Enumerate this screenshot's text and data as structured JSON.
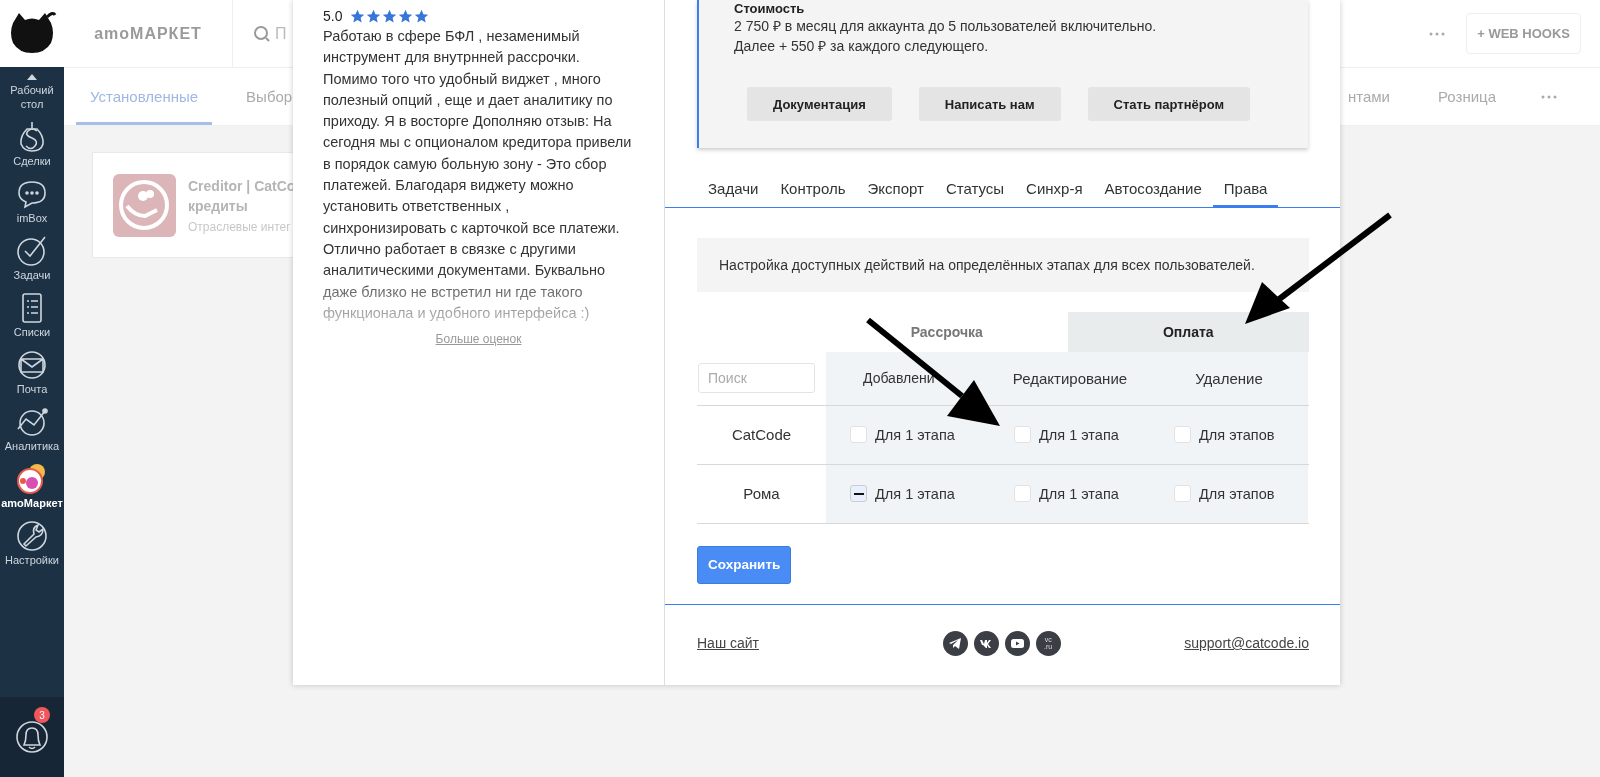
{
  "sidebar": {
    "items": [
      {
        "label": "Рабочий стол",
        "kind": "desktop",
        "selected": false
      },
      {
        "label": "Сделки",
        "kind": "deals",
        "selected": false
      },
      {
        "label": "imBox",
        "kind": "chat",
        "selected": false
      },
      {
        "label": "Задачи",
        "kind": "tasks",
        "selected": false
      },
      {
        "label": "Списки",
        "kind": "lists",
        "selected": false
      },
      {
        "label": "Почта",
        "kind": "mail",
        "selected": false
      },
      {
        "label": "Аналитика",
        "kind": "analytics",
        "selected": false
      },
      {
        "label": "amoМаркет",
        "kind": "market",
        "selected": true
      },
      {
        "label": "Настройки",
        "kind": "settings",
        "selected": false
      }
    ],
    "notifications": {
      "badge": "3"
    }
  },
  "topbar": {
    "title": "amoМАРКЕТ",
    "search_placeholder": "П",
    "webhooks_button": "+ WEB HOOKS"
  },
  "page_tabs": [
    {
      "label": "Установленные",
      "selected": true
    },
    {
      "label": "Выбор",
      "selected": false
    },
    {
      "label": "нтами",
      "selected": false
    },
    {
      "label": "Розница",
      "selected": false
    }
  ],
  "widget_card": {
    "title_lines": [
      "Creditor | CatCo",
      "кредиты"
    ],
    "category": "Отраслевые интег"
  },
  "review": {
    "rating": "5.0",
    "stars": 5,
    "text": "Работаю в сфере БФЛ , незаменимый инструмент для внутрнней рассрочки. Помимо того что удобный виджет , много полезный опций , еще и дает аналитику по приходу. Я в восторге Дополняю отзыв: На сегодня мы с опционалом кредитора привели в порядок самую больную зону - Это сбор платежей. Благодаря виджету можно установить ответственных , синхронизировать с карточкой все платежи. Отлично работает в связке с другими аналитическими документами. Буквально даже близко не встретил ни где такого функционала и удобного интерфейса :)",
    "more_link": "Больше оценок"
  },
  "pricing": {
    "heading": "Стоимость",
    "lines": [
      "2 750 ₽ в месяц для аккаунта до 5 пользователей включительно.",
      "Далее + 550 ₽ за каждого следующего."
    ],
    "buttons": [
      "Документация",
      "Написать нам",
      "Стать партнёром"
    ]
  },
  "tabs": [
    {
      "label": "Задачи",
      "selected": false
    },
    {
      "label": "Контроль",
      "selected": false
    },
    {
      "label": "Экспорт",
      "selected": false
    },
    {
      "label": "Статусы",
      "selected": false
    },
    {
      "label": "Синхр-я",
      "selected": false
    },
    {
      "label": "Автосоздание",
      "selected": false
    },
    {
      "label": "Права",
      "selected": true
    }
  ],
  "info": "Настройка доступных действий на определённых этапах для всех пользователей.",
  "subtabs": [
    {
      "label": "Рассрочка",
      "selected": false
    },
    {
      "label": "Оплата",
      "selected": true
    }
  ],
  "table": {
    "search_placeholder": "Поиск",
    "columns": [
      "Добавлени",
      "Редактирование",
      "Удаление"
    ],
    "rows": [
      {
        "name": "CatCode",
        "cells": [
          {
            "label": "Для 1 этапа",
            "indeterminate": false
          },
          {
            "label": "Для 1 этапа",
            "indeterminate": false
          },
          {
            "label": "Для этапов",
            "indeterminate": false
          }
        ]
      },
      {
        "name": "Рома",
        "cells": [
          {
            "label": "Для 1 этапа",
            "indeterminate": true
          },
          {
            "label": "Для 1 этапа",
            "indeterminate": false
          },
          {
            "label": "Для этапов",
            "indeterminate": false
          }
        ]
      }
    ]
  },
  "save_button": "Сохранить",
  "footer": {
    "site_link": "Наш сайт",
    "socials": [
      {
        "kind": "telegram"
      },
      {
        "kind": "vk"
      },
      {
        "kind": "youtube"
      },
      {
        "kind": "vc",
        "label": "vc .ru"
      }
    ],
    "email": "support@catcode.io"
  }
}
